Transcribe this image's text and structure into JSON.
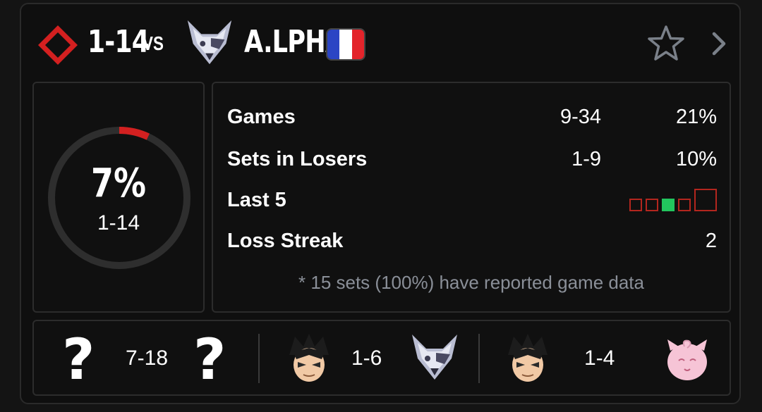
{
  "header": {
    "record": "1-14",
    "vs": "VS",
    "opponent_name": "A.LPHA",
    "player_icon": "red-diamond-icon",
    "opponent_character_icon": "wolf-icon",
    "opponent_flag": "france-flag-icon"
  },
  "summary": {
    "win_percent": "7%",
    "record": "1-14",
    "win_fraction": 0.07
  },
  "stats": {
    "games_label": "Games",
    "games_record": "9-34",
    "games_percent": "21%",
    "losers_label": "Sets in Losers",
    "losers_record": "1-9",
    "losers_percent": "10%",
    "last5_label": "Last 5",
    "last5": [
      "loss",
      "loss",
      "win",
      "loss",
      "loss"
    ],
    "streak_label": "Loss Streak",
    "streak_value": "2",
    "footnote": "* 15 sets (100%) have reported game data"
  },
  "matchups": [
    {
      "player_icon": "question-mark-icon",
      "player_glyph": "?",
      "record": "7-18",
      "opponent_icon": "question-mark-icon",
      "opponent_glyph": "?"
    },
    {
      "player_icon": "kazuya-icon",
      "record": "1-6",
      "opponent_icon": "wolf-icon"
    },
    {
      "player_icon": "kazuya-icon",
      "record": "1-4",
      "opponent_icon": "jigglypuff-icon"
    }
  ],
  "colors": {
    "accent_red": "#d32020",
    "loss_red": "#b3261e",
    "win_green": "#22c55e",
    "muted_text": "#8a8f98"
  }
}
